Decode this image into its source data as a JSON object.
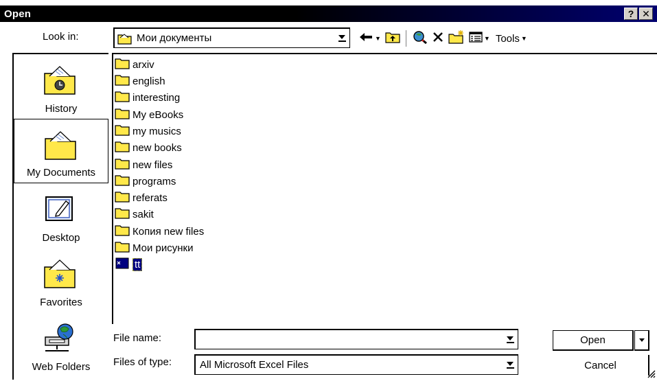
{
  "window": {
    "title": "Open",
    "help_label": "?",
    "close_label": "✕"
  },
  "lookin": {
    "label": "Look in:",
    "value": "Мои документы"
  },
  "toolbar": {
    "tools_label": "Tools"
  },
  "places": [
    {
      "label": "History",
      "icon": "history-folder-icon"
    },
    {
      "label": "My Documents",
      "icon": "my-documents-folder-icon",
      "selected": true
    },
    {
      "label": "Desktop",
      "icon": "desktop-icon"
    },
    {
      "label": "Favorites",
      "icon": "favorites-folder-icon"
    },
    {
      "label": "Web Folders",
      "icon": "web-folders-icon"
    }
  ],
  "files": [
    "arxiv",
    "english",
    "interesting",
    "My eBooks",
    "my musics",
    "new books",
    "new files",
    "programs",
    "referats",
    "sakit",
    "Копия new files",
    "Мои рисунки",
    "tt"
  ],
  "filename": {
    "label": "File name:",
    "value": ""
  },
  "filetype": {
    "label": "Files of type:",
    "value": "All Microsoft Excel Files"
  },
  "buttons": {
    "open": "Open",
    "cancel": "Cancel"
  },
  "colors": {
    "titlebar_start": "#000000",
    "titlebar_end": "#000070",
    "folder_yellow": "#ffe84a",
    "selection": "#000080"
  }
}
